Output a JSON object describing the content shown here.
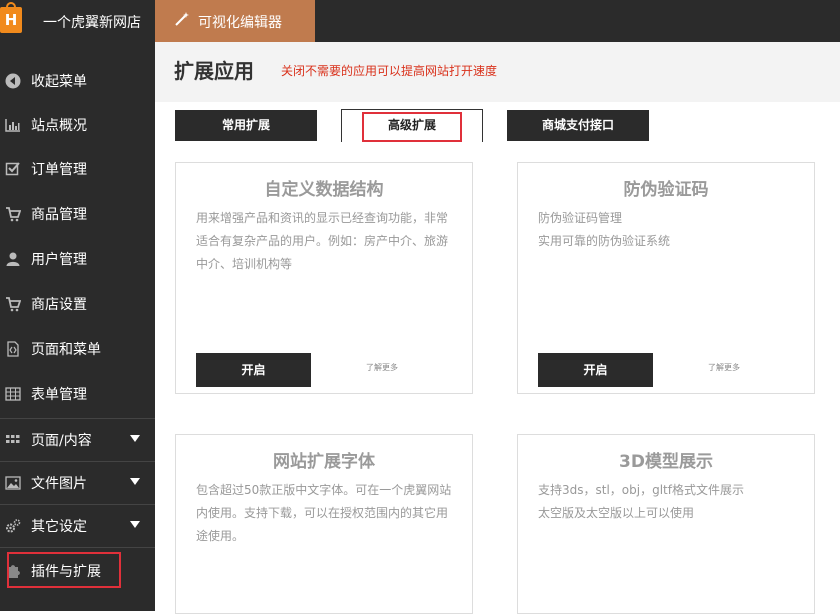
{
  "topbar": {
    "logo_letter": "H",
    "shop_name": "一个虎翼新网店",
    "editor_label": "可视化编辑器",
    "editor_icon": "magic-wand-icon"
  },
  "sidebar": {
    "items": [
      {
        "label": "收起菜单",
        "icon": "collapse-icon",
        "has_arrow": false
      },
      {
        "label": "站点概况",
        "icon": "bar-chart-icon",
        "has_arrow": false
      },
      {
        "label": "订单管理",
        "icon": "checkbox-icon",
        "has_arrow": false
      },
      {
        "label": "商品管理",
        "icon": "cart-icon",
        "has_arrow": false
      },
      {
        "label": "用户管理",
        "icon": "user-icon",
        "has_arrow": false
      },
      {
        "label": "商店设置",
        "icon": "cart-icon",
        "has_arrow": false
      },
      {
        "label": "页面和菜单",
        "icon": "code-file-icon",
        "has_arrow": false
      },
      {
        "label": "表单管理",
        "icon": "table-icon",
        "has_arrow": false
      },
      {
        "label": "页面/内容",
        "icon": "grid-icon",
        "has_arrow": true
      },
      {
        "label": "文件图片",
        "icon": "image-icon",
        "has_arrow": true
      },
      {
        "label": "其它设定",
        "icon": "gears-icon",
        "has_arrow": true
      },
      {
        "label": "插件与扩展",
        "icon": "puzzle-icon",
        "has_arrow": false
      }
    ]
  },
  "header": {
    "title": "扩展应用",
    "hint": "关闭不需要的应用可以提高网站打开速度"
  },
  "tabs": [
    {
      "label": "常用扩展",
      "active": false
    },
    {
      "label": "高级扩展",
      "active": true
    },
    {
      "label": "商城支付接口",
      "active": false
    }
  ],
  "cards": [
    {
      "title": "自定义数据结构",
      "desc": [
        "用来增强产品和资讯的显示已经查询功能，非常适合有复杂产品的用户。例如：房产中介、旅游中介、培训机构等"
      ],
      "button": "开启",
      "more": "了解更多"
    },
    {
      "title": "防伪验证码",
      "desc": [
        "防伪验证码管理",
        "实用可靠的防伪验证系统"
      ],
      "button": "开启",
      "more": "了解更多"
    },
    {
      "title": "网站扩展字体",
      "desc": [
        "包含超过50款正版中文字体。可在一个虎翼网站内使用。支持下载，可以在授权范围内的其它用途使用。"
      ]
    },
    {
      "title": "3D模型展示",
      "desc": [
        "支持3ds，stl，obj，gltf格式文件展示",
        "太空版及太空版以上可以使用"
      ]
    }
  ],
  "colors": {
    "dark": "#2b2b2b",
    "brand_orange": "#f18a1c",
    "editor_tab": "#c07b4e",
    "hint_red": "#d9311b",
    "highlight_red": "#e0303a"
  }
}
